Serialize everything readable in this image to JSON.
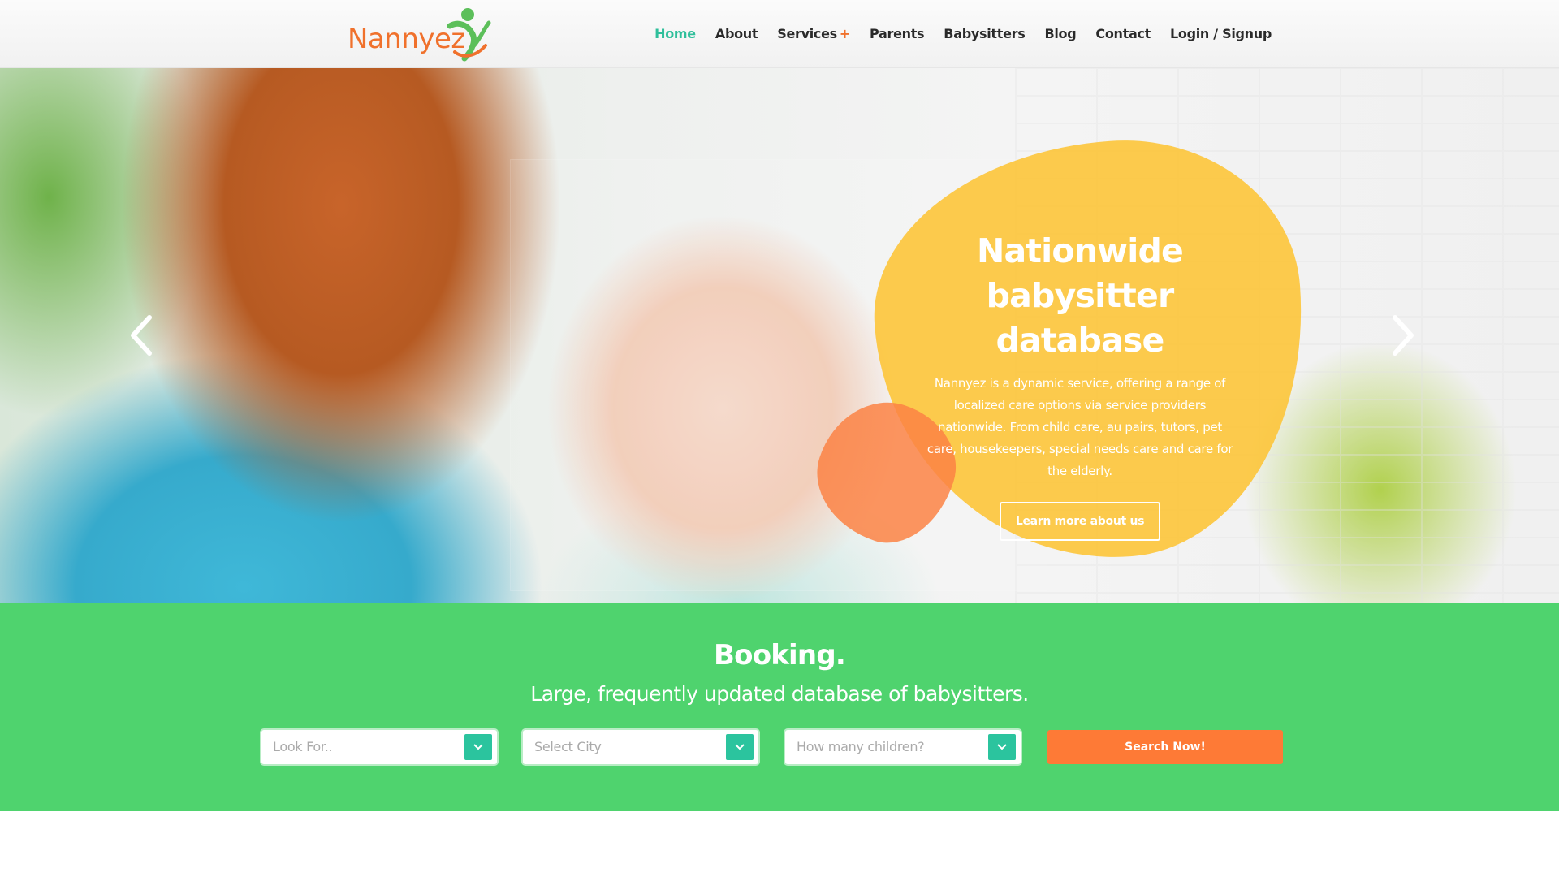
{
  "header": {
    "logo_text": "Nannyez",
    "nav": [
      {
        "label": "Home",
        "active": true
      },
      {
        "label": "About"
      },
      {
        "label": "Services",
        "suffix": "+"
      },
      {
        "label": "Parents"
      },
      {
        "label": "Babysitters"
      },
      {
        "label": "Blog"
      },
      {
        "label": "Contact"
      },
      {
        "label": "Login / Signup"
      }
    ]
  },
  "hero": {
    "title": "Nationwide babysitter database",
    "description": "Nannyez is a dynamic service, offering a range of localized care options via service providers nationwide. From child care, au pairs, tutors, pet care, housekeepers, special needs care and care for the elderly.",
    "button_label": "Learn more about us",
    "prev_icon": "chevron-left-icon",
    "next_icon": "chevron-right-icon"
  },
  "booking": {
    "title": "Booking.",
    "subtitle": "Large, frequently updated database of babysitters.",
    "selects": [
      {
        "placeholder": "Look For.."
      },
      {
        "placeholder": "Select City"
      },
      {
        "placeholder": "How many children?"
      }
    ],
    "search_label": "Search Now!"
  },
  "colors": {
    "brand_orange": "#f0712c",
    "nav_active": "#2fbf9b",
    "hero_blob": "#fdc434",
    "booking_green": "#4fd36e",
    "select_chevron": "#2bc49e",
    "search_button": "#fe7a36"
  }
}
